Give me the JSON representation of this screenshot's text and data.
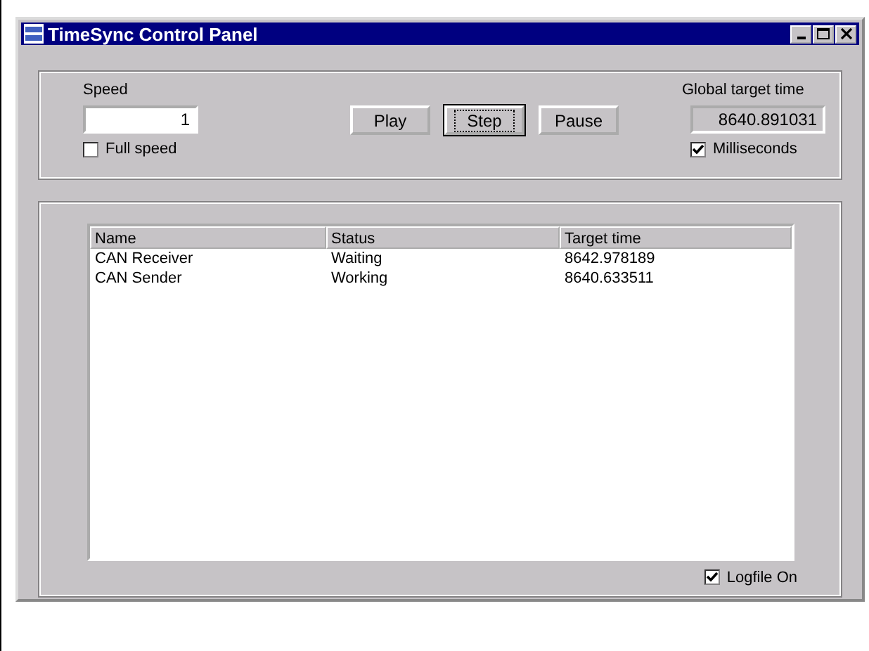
{
  "window": {
    "title": "TimeSync Control Panel"
  },
  "speed": {
    "label": "Speed",
    "value": "1"
  },
  "full_speed": {
    "label": "Full speed",
    "checked": false
  },
  "buttons": [
    {
      "label": "Play",
      "focused": false
    },
    {
      "label": "Step",
      "focused": true
    },
    {
      "label": "Pause",
      "focused": false
    }
  ],
  "global_target_time": {
    "label": "Global target time",
    "value": "8640.891031"
  },
  "milliseconds": {
    "label": "Milliseconds",
    "checked": true
  },
  "table": {
    "columns": [
      "Name",
      "Status",
      "Target time"
    ],
    "rows": [
      [
        "CAN Receiver",
        "Waiting",
        "8642.978189"
      ],
      [
        "CAN Sender",
        "Working",
        "8640.633511"
      ]
    ]
  },
  "logfile": {
    "label": "Logfile On",
    "checked": true
  }
}
